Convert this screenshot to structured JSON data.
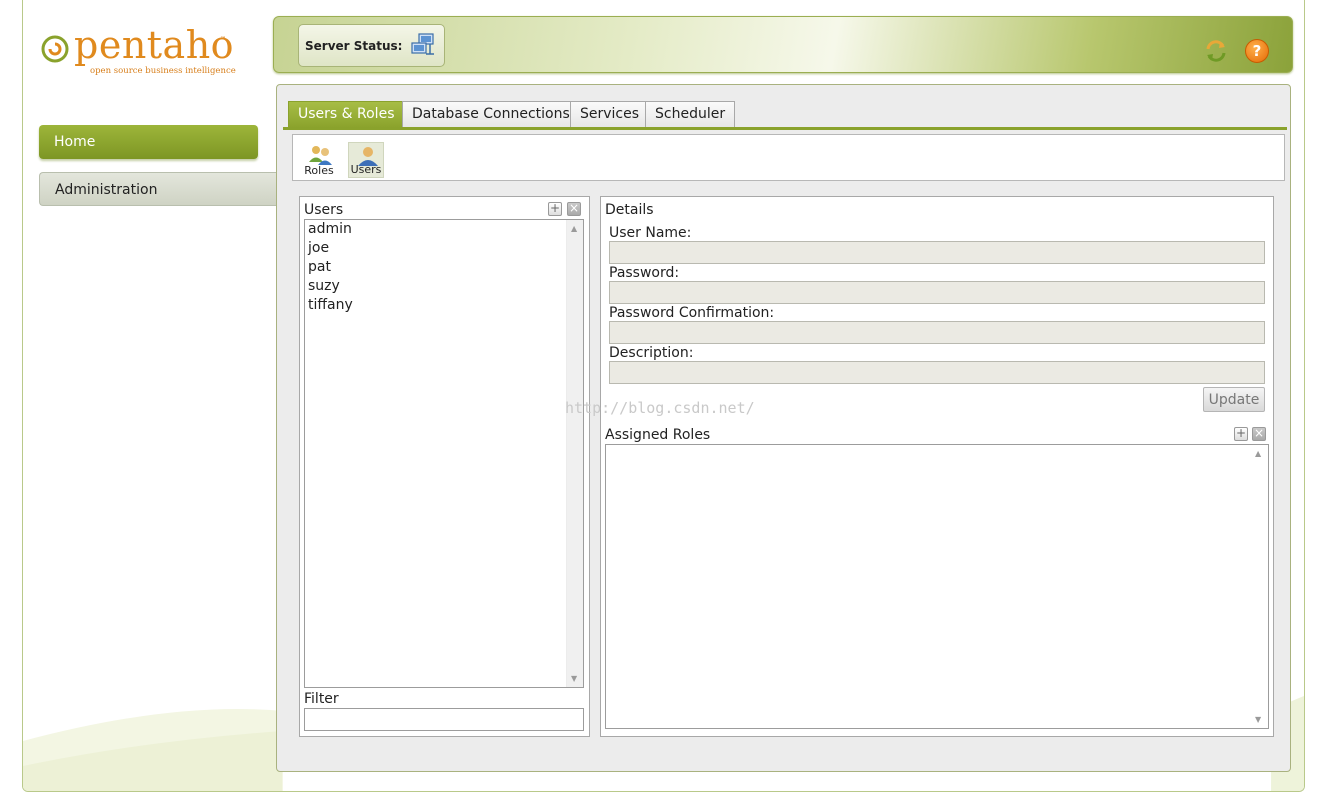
{
  "logo": {
    "word": "pentaho",
    "tagline": "open source business intelligence",
    "tm": "™"
  },
  "nav": {
    "home": "Home",
    "administration": "Administration"
  },
  "topbar": {
    "server_status_label": "Server Status:"
  },
  "tabs": [
    {
      "label": "Users & Roles",
      "active": true
    },
    {
      "label": "Database Connections",
      "active": false
    },
    {
      "label": "Services",
      "active": false
    },
    {
      "label": "Scheduler",
      "active": false
    }
  ],
  "toolbar": {
    "roles_label": "Roles",
    "users_label": "Users"
  },
  "users_panel": {
    "title": "Users",
    "items": [
      "admin",
      "joe",
      "pat",
      "suzy",
      "tiffany"
    ],
    "filter_label": "Filter",
    "filter_value": ""
  },
  "details": {
    "title": "Details",
    "user_name_label": "User Name:",
    "password_label": "Password:",
    "password_confirmation_label": "Password Confirmation:",
    "description_label": "Description:",
    "user_name_value": "",
    "password_value": "",
    "password_confirmation_value": "",
    "description_value": "",
    "update_label": "Update",
    "assigned_roles_title": "Assigned Roles"
  },
  "watermark": "http://blog.csdn.net/",
  "colors": {
    "brand_green": "#8aa22c",
    "brand_orange": "#e08a1e",
    "help_orange": "#e36a06"
  }
}
